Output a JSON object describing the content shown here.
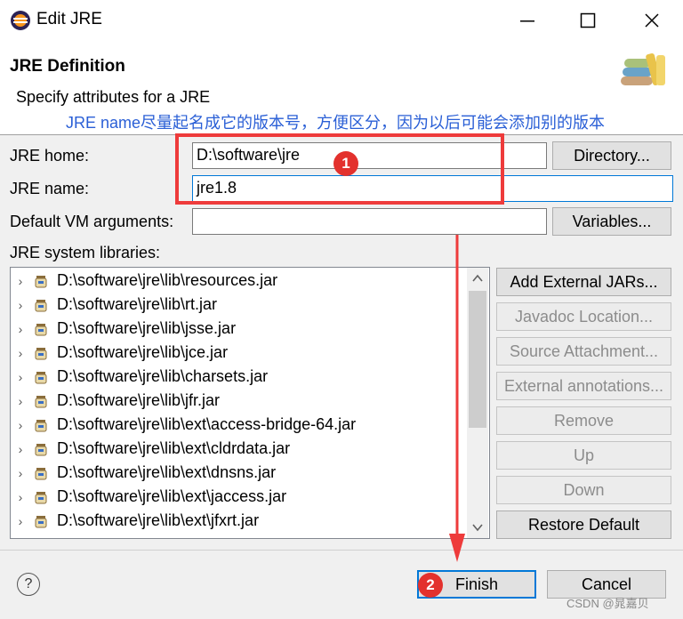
{
  "window": {
    "title": "Edit JRE",
    "buttons": [
      "minimize",
      "maximize",
      "close"
    ]
  },
  "header": {
    "title": "JRE Definition",
    "description": "Specify attributes for a JRE",
    "annotation_note": "JRE name尽量起名成它的版本号，方便区分，因为以后可能会添加别的版本"
  },
  "form": {
    "jre_home": {
      "label": "JRE home:",
      "value": "D:\\software\\jre",
      "button": "Directory..."
    },
    "jre_name": {
      "label": "JRE name:",
      "value": "jre1.8"
    },
    "vm_args": {
      "label": "Default VM arguments:",
      "value": "",
      "button": "Variables..."
    },
    "libraries_label": "JRE system libraries:"
  },
  "libraries": [
    "D:\\software\\jre\\lib\\resources.jar",
    "D:\\software\\jre\\lib\\rt.jar",
    "D:\\software\\jre\\lib\\jsse.jar",
    "D:\\software\\jre\\lib\\jce.jar",
    "D:\\software\\jre\\lib\\charsets.jar",
    "D:\\software\\jre\\lib\\jfr.jar",
    "D:\\software\\jre\\lib\\ext\\access-bridge-64.jar",
    "D:\\software\\jre\\lib\\ext\\cldrdata.jar",
    "D:\\software\\jre\\lib\\ext\\dnsns.jar",
    "D:\\software\\jre\\lib\\ext\\jaccess.jar",
    "D:\\software\\jre\\lib\\ext\\jfxrt.jar"
  ],
  "side_buttons": {
    "add_external_jars": "Add External JARs...",
    "javadoc_location": "Javadoc Location...",
    "source_attachment": "Source Attachment...",
    "external_annotations": "External annotations...",
    "remove": "Remove",
    "up": "Up",
    "down": "Down",
    "restore_default": "Restore Default"
  },
  "footer": {
    "help": "?",
    "finish": "Finish",
    "cancel": "Cancel"
  },
  "annotations": {
    "step1": "1",
    "step2": "2",
    "color": "#ee3b3b"
  },
  "watermark": "CSDN @晁嘉贝"
}
